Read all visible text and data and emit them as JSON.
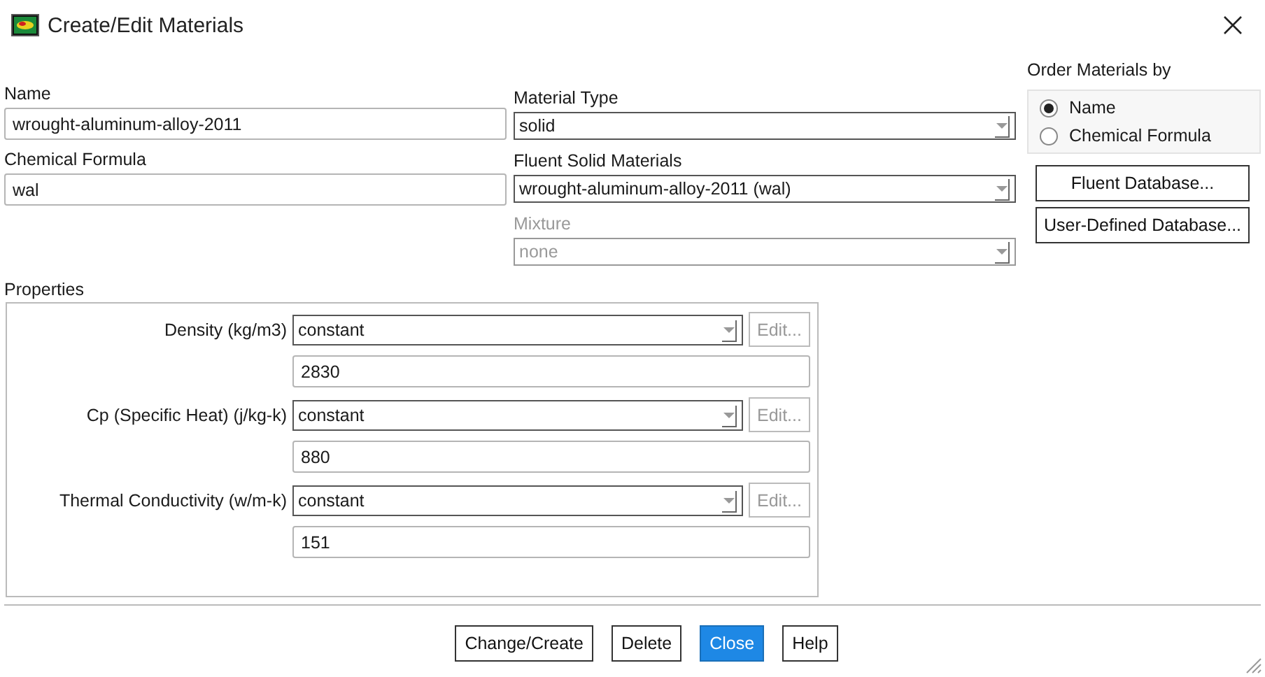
{
  "window": {
    "title": "Create/Edit Materials"
  },
  "name": {
    "label": "Name",
    "value": "wrought-aluminum-alloy-2011"
  },
  "chemical_formula": {
    "label": "Chemical Formula",
    "value": "wal"
  },
  "material_type": {
    "label": "Material Type",
    "value": "solid",
    "disabled": false
  },
  "fluent_solid_materials": {
    "label": "Fluent Solid Materials",
    "value": "wrought-aluminum-alloy-2011 (wal)",
    "disabled": false
  },
  "mixture": {
    "label": "Mixture",
    "value": "none",
    "disabled": true
  },
  "order_by": {
    "label": "Order Materials by",
    "options": [
      {
        "label": "Name",
        "selected": true
      },
      {
        "label": "Chemical Formula",
        "selected": false
      }
    ]
  },
  "database_buttons": [
    "Fluent Database...",
    "User-Defined Database..."
  ],
  "properties": {
    "label": "Properties",
    "rows": [
      {
        "label": "Density (kg/m3)",
        "method": "constant",
        "edit_button": "Edit...",
        "edit_disabled": true,
        "value": "2830"
      },
      {
        "label": "Cp (Specific Heat) (j/kg-k)",
        "method": "constant",
        "edit_button": "Edit...",
        "edit_disabled": true,
        "value": "880"
      },
      {
        "label": "Thermal Conductivity (w/m-k)",
        "method": "constant",
        "edit_button": "Edit...",
        "edit_disabled": true,
        "value": "151"
      }
    ]
  },
  "buttons": [
    {
      "label": "Change/Create",
      "default": false
    },
    {
      "label": "Delete",
      "default": false
    },
    {
      "label": "Close",
      "default": true
    },
    {
      "label": "Help",
      "default": false
    }
  ]
}
